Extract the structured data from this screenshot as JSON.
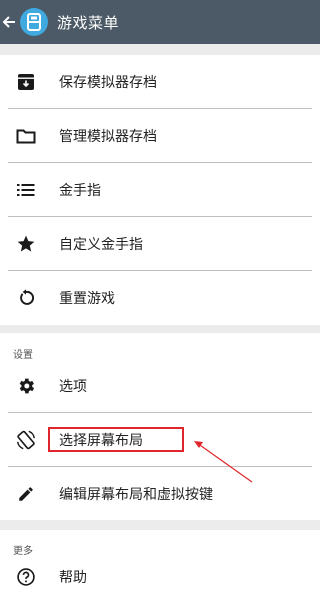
{
  "appbar": {
    "title": "游戏菜单",
    "color": "#4b5a66",
    "logo_color": "#3fa9e0"
  },
  "menu": {
    "items": [
      {
        "label": "保存模拟器存档",
        "icon": "save-box-icon"
      },
      {
        "label": "管理模拟器存档",
        "icon": "folder-icon"
      },
      {
        "label": "金手指",
        "icon": "list-icon"
      },
      {
        "label": "自定义金手指",
        "icon": "star-icon"
      },
      {
        "label": "重置游戏",
        "icon": "restart-icon"
      }
    ]
  },
  "settings": {
    "header": "设置",
    "items": [
      {
        "label": "选项",
        "icon": "gear-icon"
      },
      {
        "label": "选择屏幕布局",
        "icon": "screen-rotation-icon"
      },
      {
        "label": "编辑屏幕布局和虚拟按键",
        "icon": "pencil-icon"
      }
    ]
  },
  "more": {
    "header": "更多",
    "items": [
      {
        "label": "帮助",
        "icon": "help-icon"
      }
    ]
  },
  "annotation": {
    "highlight_color": "#e0262b"
  }
}
